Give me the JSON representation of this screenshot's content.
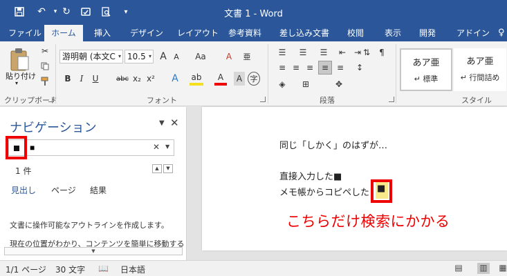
{
  "titlebar": {
    "title": "文書 1 - Word"
  },
  "quick_access": {
    "icons": [
      "save-icon",
      "undo-icon",
      "redo-icon",
      "touch-mode-icon",
      "print-preview-icon",
      "customize-icon"
    ]
  },
  "tabs": [
    "ファイル",
    "ホーム",
    "挿入",
    "デザイン",
    "レイアウト",
    "参考資料",
    "差し込み文書",
    "校閲",
    "表示",
    "開発",
    "アドイン"
  ],
  "active_tab": "ホーム",
  "ribbon": {
    "clipboard": {
      "paste_label": "貼り付け",
      "group_label": "クリップボード"
    },
    "font": {
      "font_name": "游明朝 (本文C",
      "font_size": "10.5",
      "grow": "A",
      "shrink": "A",
      "case": "Aa",
      "clear_format": "A",
      "bold": "B",
      "italic": "I",
      "underline": "U",
      "strike": "abc",
      "sub": "x₂",
      "sup": "x²",
      "text_effect": "A",
      "highlight": "ab",
      "font_color": "A",
      "char_shade": "A",
      "enclose": "字",
      "group_label": "フォント"
    },
    "paragraph": {
      "group_label": "段落"
    },
    "styles": {
      "items": [
        {
          "sample": "あア亜",
          "name": "↵ 標準"
        },
        {
          "sample": "あア亜",
          "name": "↵ 行間詰め"
        }
      ],
      "group_label": "スタイル"
    }
  },
  "navigation": {
    "title": "ナビゲーション",
    "search_value": "■",
    "result_count": "1 件",
    "tabs": [
      "見出し",
      "ページ",
      "結果"
    ],
    "info_line1": "文書に操作可能なアウトラインを作成します。",
    "info_line2": "現在の位置がわかり、コンテンツを簡単に移動する"
  },
  "document": {
    "lines": [
      "同じ「しかく」のはずが…",
      "直接入力した■",
      "メモ帳からコピペした"
    ],
    "highlighted_char": "■"
  },
  "annotation": "こちらだけ検索にかかる",
  "statusbar": {
    "page": "1/1 ページ",
    "words": "30 文字",
    "language": "日本語"
  }
}
